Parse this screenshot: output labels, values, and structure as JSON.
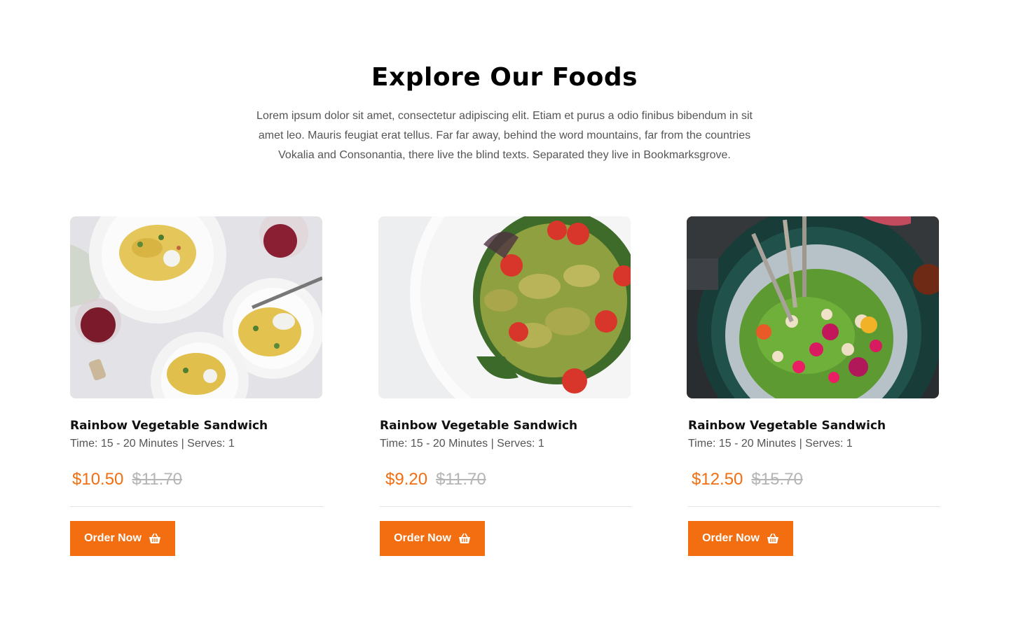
{
  "section": {
    "title": "Explore Our Foods",
    "description": "Lorem ipsum dolor sit amet, consectetur adipiscing elit. Etiam et purus a odio finibus bibendum in sit amet leo. Mauris feugiat erat tellus. Far far away, behind the word mountains, far from the countries Vokalia and Consonantia, there live the blind texts. Separated they live in Bookmarksgrove."
  },
  "foods": [
    {
      "image": "spaghetti-plates-photo",
      "name": "Rainbow Vegetable Sandwich",
      "meta": "Time: 15 - 20 Minutes | Serves: 1",
      "price": "$10.50",
      "old_price": "$11.70",
      "button_label": "Order Now",
      "button_icon": "basket-icon"
    },
    {
      "image": "bowtie-pasta-salad-photo",
      "name": "Rainbow Vegetable Sandwich",
      "meta": "Time: 15 - 20 Minutes | Serves: 1",
      "price": "$9.20",
      "old_price": "$11.70",
      "button_label": "Order Now",
      "button_icon": "basket-icon"
    },
    {
      "image": "green-salad-bowl-photo",
      "name": "Rainbow Vegetable Sandwich",
      "meta": "Time: 15 - 20 Minutes | Serves: 1",
      "price": "$12.50",
      "old_price": "$15.70",
      "button_label": "Order Now",
      "button_icon": "basket-icon"
    }
  ],
  "colors": {
    "accent": "#f26e10",
    "old_price": "#b5b5b5",
    "text_muted": "#555555"
  }
}
